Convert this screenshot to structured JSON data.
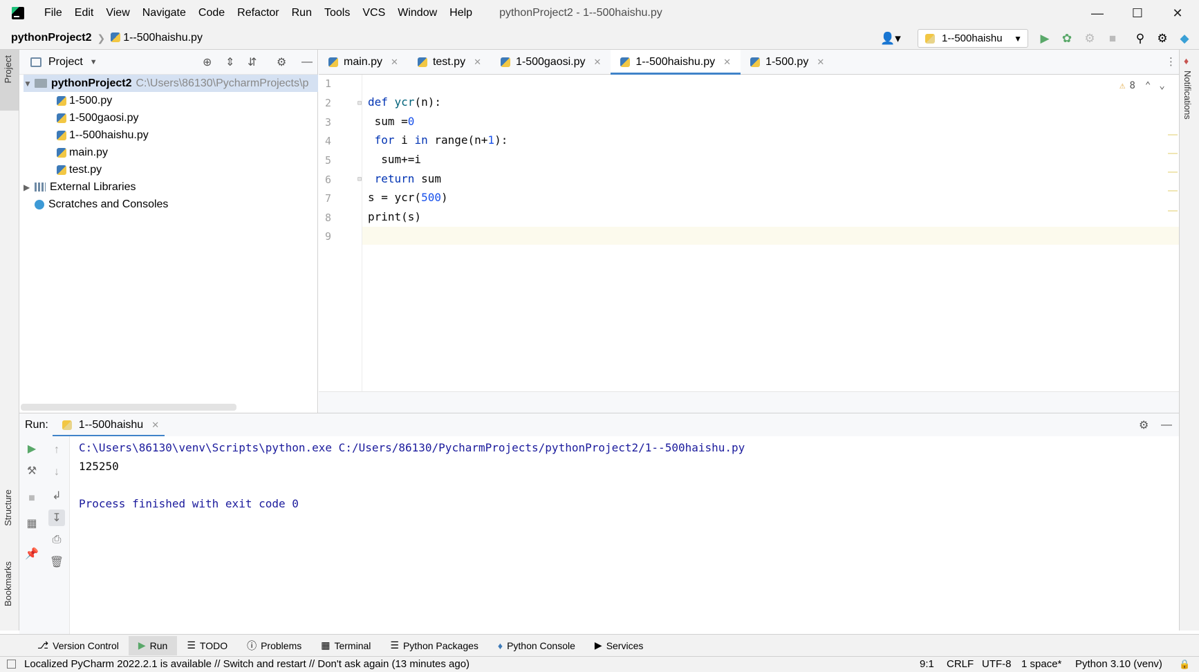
{
  "window": {
    "menu": [
      "File",
      "Edit",
      "View",
      "Navigate",
      "Code",
      "Refactor",
      "Run",
      "Tools",
      "VCS",
      "Window",
      "Help"
    ],
    "title": "pythonProject2 - 1--500haishu.py"
  },
  "navbar": {
    "project": "pythonProject2",
    "file": "1--500haishu.py",
    "run_config": "1--500haishu"
  },
  "project_panel": {
    "title": "Project",
    "root_name": "pythonProject2",
    "root_path": "C:\\Users\\86130\\PycharmProjects\\p",
    "files": [
      "1-500.py",
      "1-500gaosi.py",
      "1--500haishu.py",
      "main.py",
      "test.py"
    ],
    "external_libraries": "External Libraries",
    "scratches": "Scratches and Consoles"
  },
  "left_strip": {
    "project": "Project",
    "structure": "Structure",
    "bookmarks": "Bookmarks"
  },
  "right_strip": {
    "notifications": "Notifications"
  },
  "editor": {
    "tabs": [
      "main.py",
      "test.py",
      "1-500gaosi.py",
      "1--500haishu.py",
      "1-500.py"
    ],
    "active_tab": "1--500haishu.py",
    "warnings": "8",
    "line_numbers": [
      "1",
      "2",
      "3",
      "4",
      "5",
      "6",
      "7",
      "8",
      "9"
    ],
    "code": {
      "l2_kw": "def",
      "l2_fn": "ycr",
      "l2_rest": "(n):",
      "l3_a": " sum =",
      "l3_num": "0",
      "l4_kw1": "for",
      "l4_a": " i ",
      "l4_kw2": "in",
      "l4_b": " range(n+",
      "l4_num": "1",
      "l4_c": "):",
      "l5": "  sum+=i",
      "l6_kw": "return",
      "l6_rest": " sum",
      "l7_a": "s = ycr(",
      "l7_num": "500",
      "l7_b": ")",
      "l8": "print(s)"
    }
  },
  "run_panel": {
    "label": "Run:",
    "tab": "1--500haishu",
    "output": [
      "C:\\Users\\86130\\venv\\Scripts\\python.exe C:/Users/86130/PycharmProjects/pythonProject2/1--500haishu.py",
      "125250",
      "",
      "Process finished with exit code 0"
    ]
  },
  "bottom_tabs": [
    "Version Control",
    "Run",
    "TODO",
    "Problems",
    "Terminal",
    "Python Packages",
    "Python Console",
    "Services"
  ],
  "statusbar": {
    "message": "Localized PyCharm 2022.2.1 is available // Switch and restart // Don't ask again (13 minutes ago)",
    "position": "9:1",
    "line_sep": "CRLF",
    "encoding": "UTF-8",
    "indent": "1 space*",
    "interpreter": "Python 3.10 (venv)"
  },
  "colors": {
    "accent": "#4083c9",
    "keyword": "#0033b3",
    "number": "#1750eb",
    "run_green": "#59a869"
  }
}
